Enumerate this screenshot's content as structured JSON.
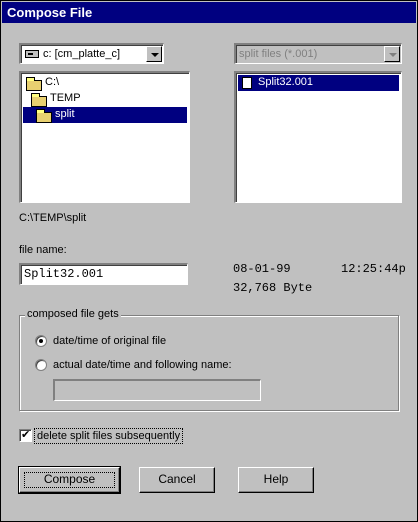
{
  "title": "Compose File",
  "drive": {
    "value": "c: [cm_platte_c]",
    "icon": "drive-icon"
  },
  "file_filter": {
    "value": "split files (*.001)"
  },
  "dirs": [
    {
      "label": "C:\\"
    },
    {
      "label": "TEMP"
    },
    {
      "label": "split"
    }
  ],
  "files": [
    {
      "label": "Split32.001"
    }
  ],
  "current_path": "C:\\TEMP\\split",
  "filename": {
    "label": "file name:",
    "value": "Split32.001"
  },
  "file_info": {
    "date": "08-01-99",
    "time": "12:25:44p",
    "size": "32,768 Byte"
  },
  "group": {
    "legend": "composed file gets",
    "option1": "date/time of original file",
    "option2": "actual date/time and following name:",
    "selected": "option1",
    "name_value": ""
  },
  "delete_checkbox": {
    "label": "delete split files subsequently",
    "checked": true
  },
  "buttons": {
    "compose": "Compose",
    "cancel": "Cancel",
    "help": "Help"
  }
}
